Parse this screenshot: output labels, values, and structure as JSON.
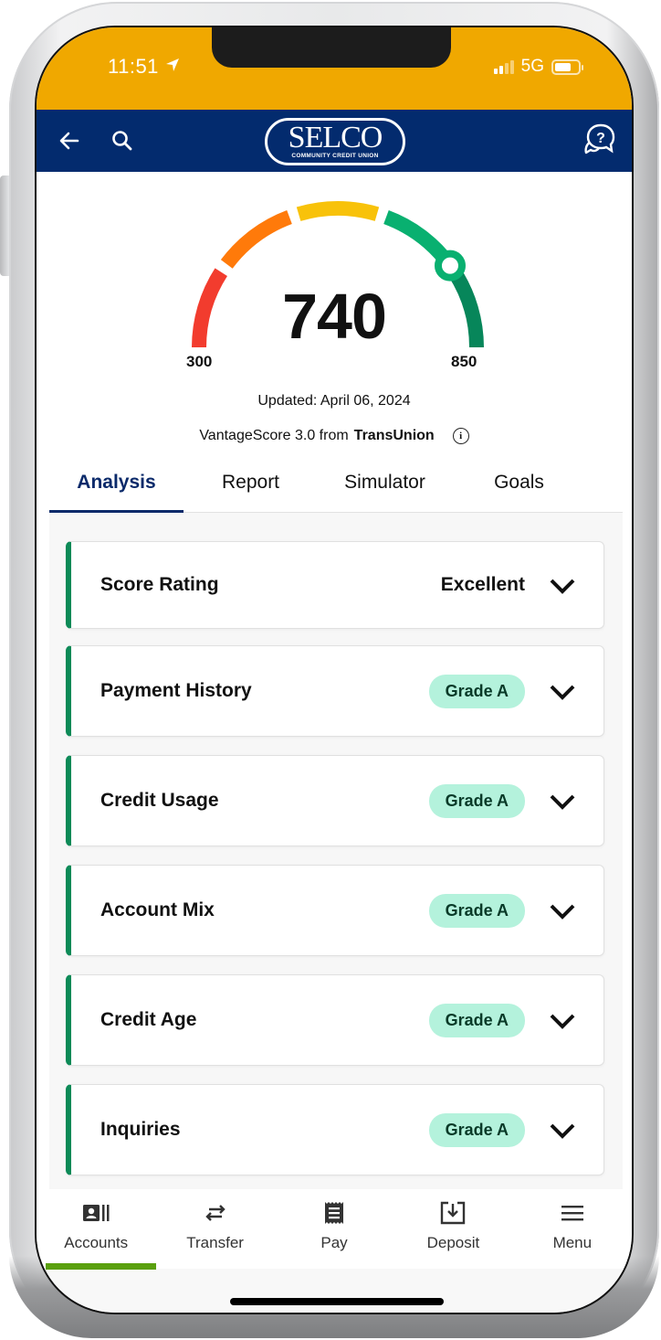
{
  "status_bar": {
    "time": "11:51",
    "network": "5G",
    "location_icon": "location-arrow-icon",
    "signal_bars_active": 2,
    "signal_bars_total": 4
  },
  "header": {
    "back_icon": "arrow-left-icon",
    "search_icon": "search-icon",
    "logo_main": "SELCO",
    "logo_sub": "COMMUNITY CREDIT UNION",
    "help_icon": "chat-question-icon",
    "colors": {
      "status_bar": "#f0a800",
      "header": "#032b6e"
    }
  },
  "gauge": {
    "score": "740",
    "min": "300",
    "max": "850",
    "score_value": 740,
    "segments": [
      {
        "name": "poor",
        "color": "#f23c2e"
      },
      {
        "name": "fair",
        "color": "#ff7a0a"
      },
      {
        "name": "good",
        "color": "#f8c20a"
      },
      {
        "name": "very-good",
        "color": "#09b070"
      },
      {
        "name": "excellent",
        "color": "#07865a"
      }
    ]
  },
  "updated": "Updated: April 06, 2024",
  "source": {
    "prefix": "VantageScore 3.0 from",
    "bureau": "TransUnion",
    "info_icon": "info-icon",
    "info_glyph": "i"
  },
  "tabs": [
    {
      "label": "Analysis",
      "active": true
    },
    {
      "label": "Report",
      "active": false
    },
    {
      "label": "Simulator",
      "active": false
    },
    {
      "label": "Goals",
      "active": false
    }
  ],
  "cards": [
    {
      "title": "Score Rating",
      "value": "Excellent",
      "type": "text"
    },
    {
      "title": "Payment History",
      "value": "Grade A",
      "type": "badge"
    },
    {
      "title": "Credit Usage",
      "value": "Grade A",
      "type": "badge"
    },
    {
      "title": "Account Mix",
      "value": "Grade A",
      "type": "badge"
    },
    {
      "title": "Credit Age",
      "value": "Grade A",
      "type": "badge"
    },
    {
      "title": "Inquiries",
      "value": "Grade A",
      "type": "badge"
    }
  ],
  "bottom_nav": [
    {
      "label": "Accounts",
      "icon": "accounts-card-icon",
      "active": true
    },
    {
      "label": "Transfer",
      "icon": "transfer-arrows-icon",
      "active": false
    },
    {
      "label": "Pay",
      "icon": "receipt-icon",
      "active": false
    },
    {
      "label": "Deposit",
      "icon": "deposit-download-icon",
      "active": false
    },
    {
      "label": "Menu",
      "icon": "hamburger-menu-icon",
      "active": false
    }
  ],
  "accent_colors": {
    "active_tab": "#0b2a6a",
    "card_accent": "#0c8a57",
    "badge_bg": "#b4f2dc",
    "nav_indicator": "#5aa00e"
  }
}
